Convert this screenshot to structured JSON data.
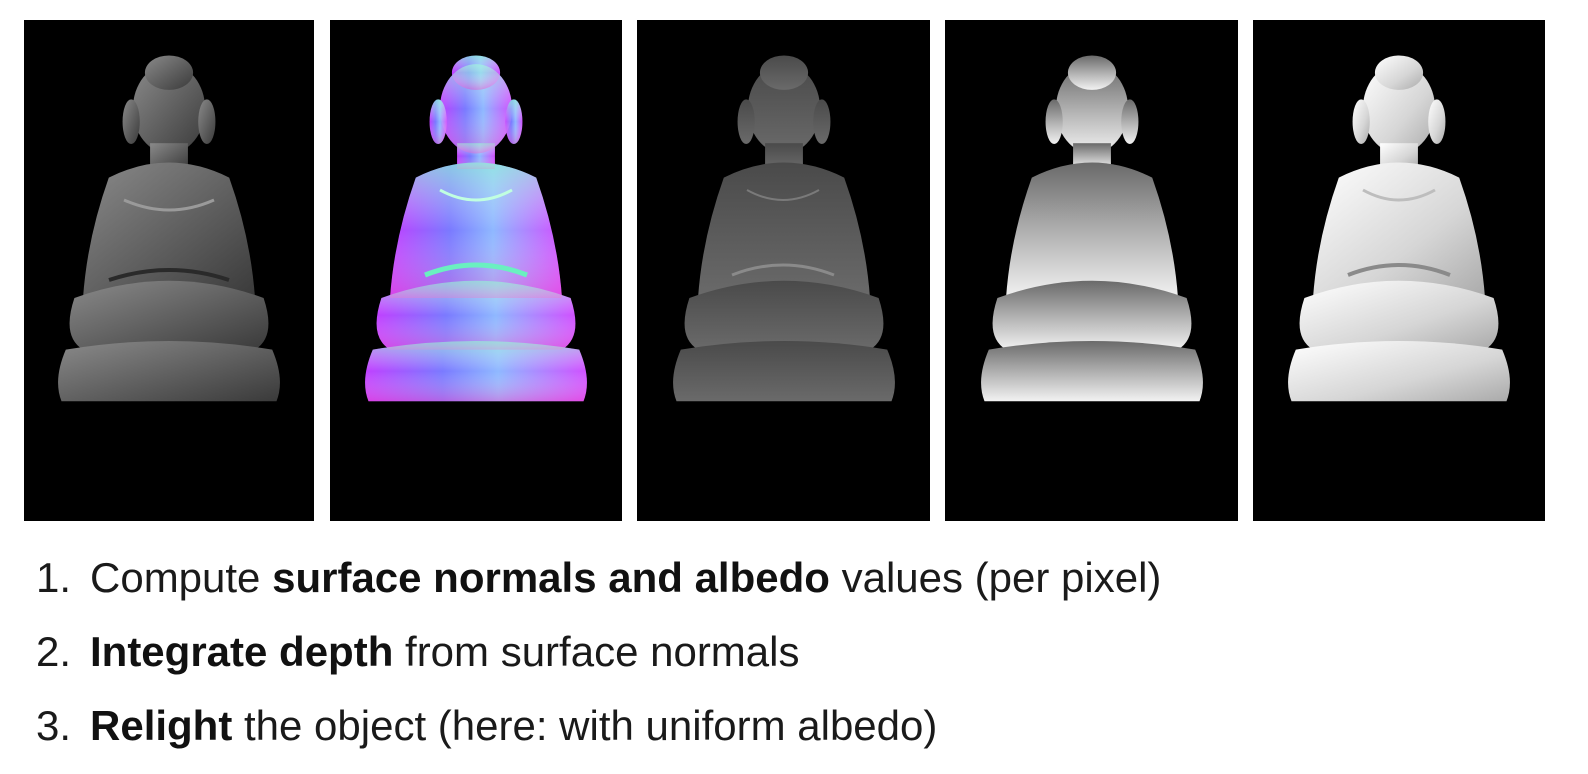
{
  "panels": [
    {
      "name": "input-photo-panel",
      "kind": "photo"
    },
    {
      "name": "surface-normals-panel",
      "kind": "normals"
    },
    {
      "name": "albedo-panel",
      "kind": "albedo"
    },
    {
      "name": "depth-panel",
      "kind": "depth"
    },
    {
      "name": "relit-panel",
      "kind": "relit"
    }
  ],
  "steps": [
    {
      "number": "1.",
      "pre": "Compute ",
      "bold": "surface normals and albedo",
      "post": " values (per pixel)"
    },
    {
      "number": "2.",
      "pre": "",
      "bold": "Integrate depth",
      "post": " from surface normals"
    },
    {
      "number": "3.",
      "pre": "",
      "bold": "Relight",
      "post": " the object (here: with uniform albedo)"
    }
  ],
  "colors": {
    "panel_background": "#000000",
    "text": "#1a1a1a"
  }
}
